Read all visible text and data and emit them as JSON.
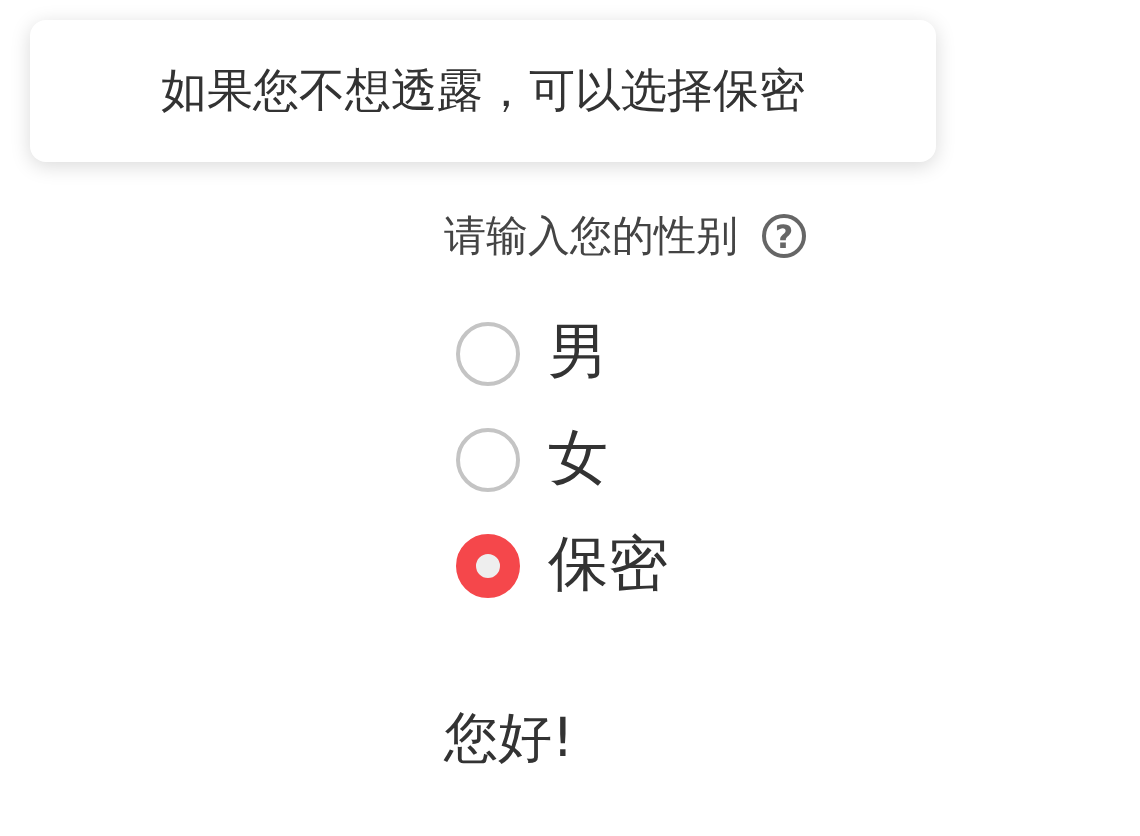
{
  "tooltip": {
    "text": "如果您不想透露，可以选择保密"
  },
  "field": {
    "label": "请输入您的性别",
    "help_icon": "?"
  },
  "options": [
    {
      "label": "男",
      "selected": false
    },
    {
      "label": "女",
      "selected": false
    },
    {
      "label": "保密",
      "selected": true
    }
  ],
  "greeting": "您好!"
}
